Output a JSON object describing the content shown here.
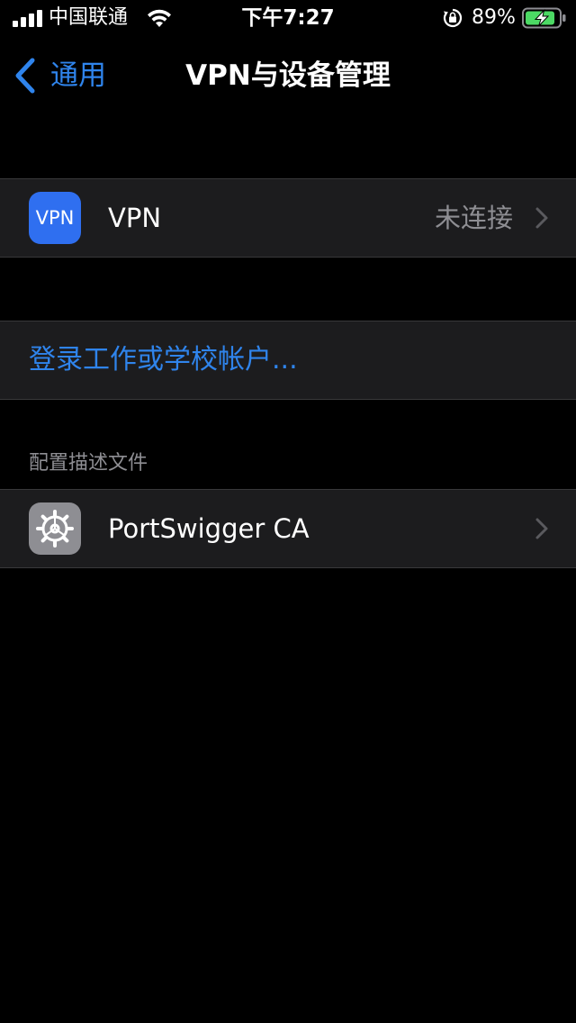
{
  "status_bar": {
    "carrier": "中国联通",
    "time": "下午7:27",
    "battery_percent": "89%",
    "battery_level": 0.89,
    "charging": true,
    "battery_color": "#4cd964"
  },
  "nav": {
    "back_label": "通用",
    "title": "VPN与设备管理"
  },
  "vpn_row": {
    "icon_text": "VPN",
    "label": "VPN",
    "value": "未连接"
  },
  "account_row": {
    "label": "登录工作或学校帐户..."
  },
  "profiles_section": {
    "header": "配置描述文件",
    "items": [
      {
        "label": "PortSwigger CA",
        "icon": "gear-icon"
      }
    ]
  },
  "colors": {
    "background": "#000000",
    "cell_background": "#1c1c1e",
    "accent": "#2f84ec",
    "vpn_icon_bg": "#2f6ff0",
    "secondary_text": "#8e8e93"
  }
}
